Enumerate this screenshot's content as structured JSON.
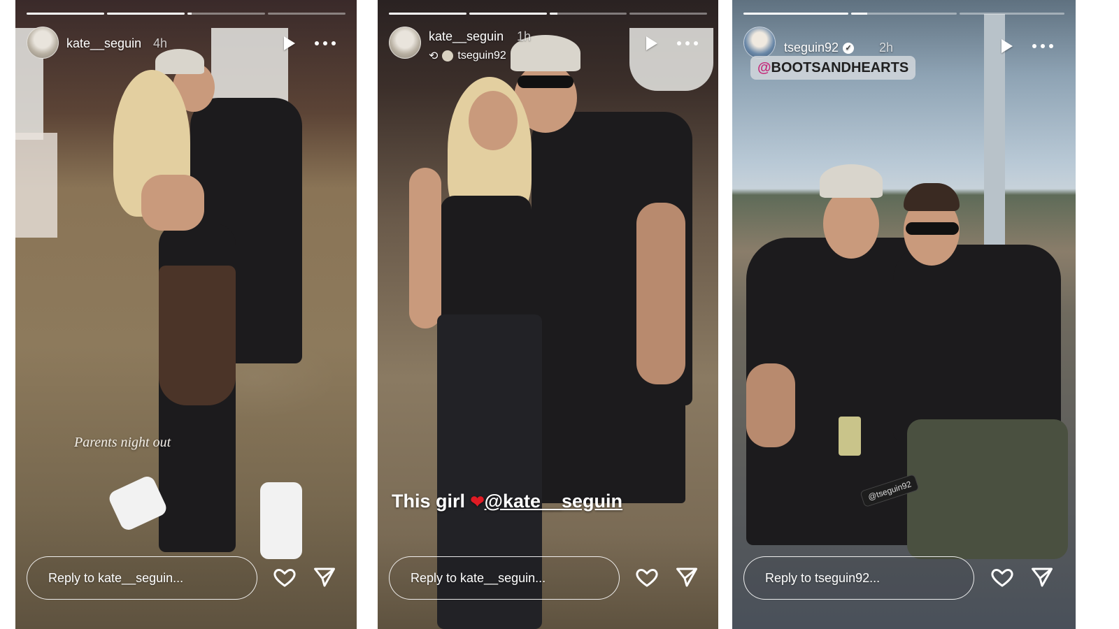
{
  "stories": [
    {
      "username": "kate__seguin",
      "time": "4h",
      "progress": [
        1,
        1,
        0.05,
        0
      ],
      "overlay_text": "Parents night out",
      "reply_placeholder": "Reply to kate__seguin...",
      "icons": {
        "play": "play-icon",
        "more": "more-icon",
        "like": "heart-icon",
        "share": "send-icon"
      }
    },
    {
      "username": "kate__seguin",
      "time": "1h",
      "reshared_from": "tseguin92",
      "progress": [
        1,
        1,
        0.1,
        0
      ],
      "caption_prefix": "This girl ",
      "caption_heart": "❤",
      "caption_mention": "@kate__seguin",
      "reply_placeholder": "Reply to kate__seguin...",
      "icons": {
        "play": "play-icon",
        "more": "more-icon",
        "like": "heart-icon",
        "share": "send-icon"
      }
    },
    {
      "username": "tseguin92",
      "time": "2h",
      "verified": true,
      "progress": [
        1,
        0.15,
        0
      ],
      "tag_icon": "@",
      "tag_text": "BOOTSANDHEARTS",
      "sticker_text": "@tseguin92",
      "reply_placeholder": "Reply to tseguin92...",
      "icons": {
        "play": "play-icon",
        "more": "more-icon",
        "like": "heart-icon",
        "share": "send-icon"
      }
    }
  ]
}
